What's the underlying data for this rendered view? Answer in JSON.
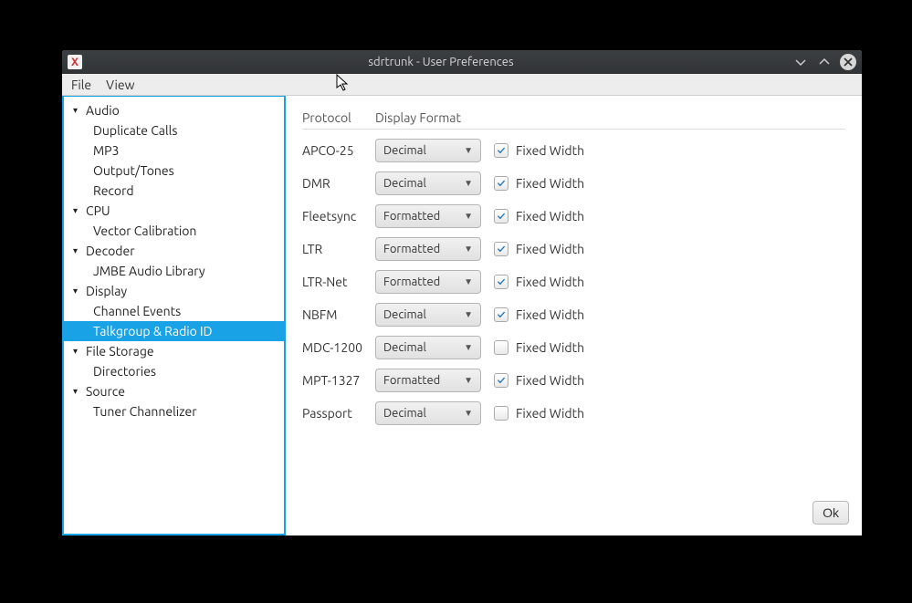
{
  "window": {
    "title": "sdrtrunk - User Preferences",
    "app_icon_letter": "X"
  },
  "menu": {
    "file": "File",
    "view": "View"
  },
  "sidebar": {
    "items": [
      {
        "label": "Audio",
        "type": "parent"
      },
      {
        "label": "Duplicate Calls",
        "type": "child"
      },
      {
        "label": "MP3",
        "type": "child"
      },
      {
        "label": "Output/Tones",
        "type": "child"
      },
      {
        "label": "Record",
        "type": "child"
      },
      {
        "label": "CPU",
        "type": "parent"
      },
      {
        "label": "Vector Calibration",
        "type": "child"
      },
      {
        "label": "Decoder",
        "type": "parent"
      },
      {
        "label": "JMBE Audio Library",
        "type": "child"
      },
      {
        "label": "Display",
        "type": "parent"
      },
      {
        "label": "Channel Events",
        "type": "child"
      },
      {
        "label": "Talkgroup & Radio ID",
        "type": "child",
        "selected": true
      },
      {
        "label": "File Storage",
        "type": "parent"
      },
      {
        "label": "Directories",
        "type": "child"
      },
      {
        "label": "Source",
        "type": "parent"
      },
      {
        "label": "Tuner Channelizer",
        "type": "child"
      }
    ]
  },
  "table": {
    "headers": {
      "protocol": "Protocol",
      "format": "Display Format"
    },
    "fixed_width_label": "Fixed Width",
    "rows": [
      {
        "protocol": "APCO-25",
        "format": "Decimal",
        "fixed": true
      },
      {
        "protocol": "DMR",
        "format": "Decimal",
        "fixed": true
      },
      {
        "protocol": "Fleetsync",
        "format": "Formatted",
        "fixed": true
      },
      {
        "protocol": "LTR",
        "format": "Formatted",
        "fixed": true
      },
      {
        "protocol": "LTR-Net",
        "format": "Formatted",
        "fixed": true
      },
      {
        "protocol": "NBFM",
        "format": "Decimal",
        "fixed": true
      },
      {
        "protocol": "MDC-1200",
        "format": "Decimal",
        "fixed": false
      },
      {
        "protocol": "MPT-1327",
        "format": "Formatted",
        "fixed": true
      },
      {
        "protocol": "Passport",
        "format": "Decimal",
        "fixed": false
      }
    ]
  },
  "buttons": {
    "ok": "Ok"
  }
}
